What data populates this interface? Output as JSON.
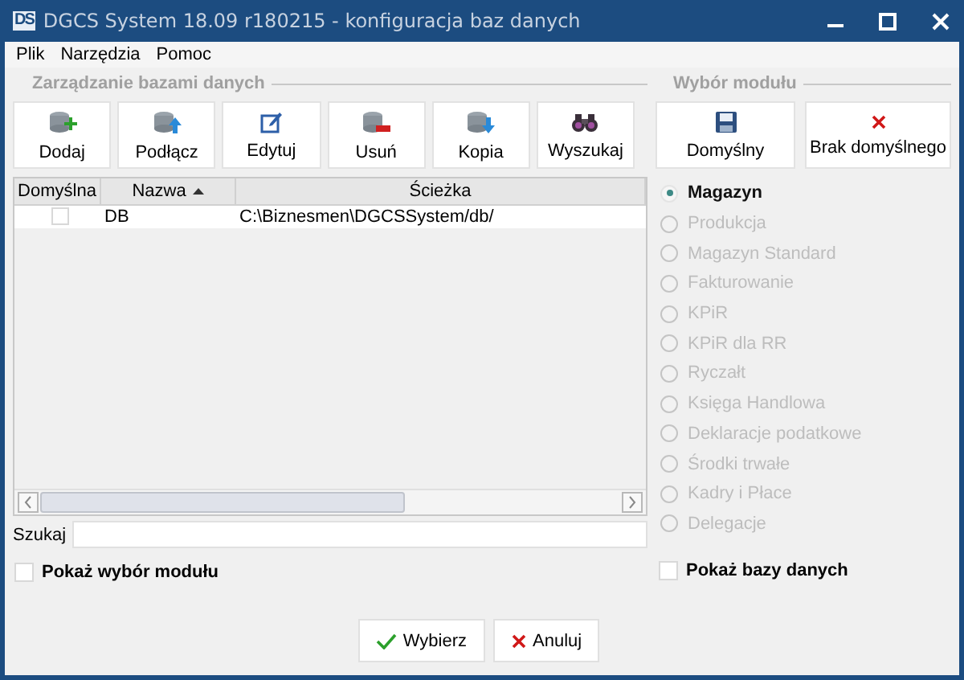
{
  "window": {
    "logo": "DS",
    "title": "DGCS System 18.09 r180215 - konfiguracja baz danych"
  },
  "menu": [
    "Plik",
    "Narzędzia",
    "Pomoc"
  ],
  "database_group": {
    "title": "Zarządzanie bazami danych",
    "buttons": [
      {
        "label": "Dodaj",
        "kind": "add"
      },
      {
        "label": "Podłącz",
        "kind": "connect"
      },
      {
        "label": "Edytuj",
        "kind": "edit"
      },
      {
        "label": "Usuń",
        "kind": "remove"
      },
      {
        "label": "Kopia",
        "kind": "copy"
      },
      {
        "label": "Wyszukaj",
        "kind": "search"
      }
    ]
  },
  "table": {
    "columns": [
      {
        "label": "Domyślna",
        "sorted": false
      },
      {
        "label": "Nazwa",
        "sorted": true
      },
      {
        "label": "Ścieżka",
        "sorted": false
      }
    ],
    "rows": [
      {
        "default": false,
        "name": "DB",
        "path": "C:\\Biznesmen\\DGCSSystem/db/"
      }
    ]
  },
  "search": {
    "label": "Szukaj"
  },
  "show_modules": {
    "label": "Pokaż wybór modułu",
    "checked": false
  },
  "module_group": {
    "title": "Wybór modułu",
    "buttons": [
      {
        "label": "Domyślny",
        "kind": "save"
      },
      {
        "label": "Brak domyślnego",
        "kind": "clear"
      }
    ],
    "modules": [
      {
        "label": "Magazyn",
        "selected": true,
        "disabled": false
      },
      {
        "label": "Produkcja",
        "selected": false,
        "disabled": true
      },
      {
        "label": "Magazyn Standard",
        "selected": false,
        "disabled": true
      },
      {
        "label": "Fakturowanie",
        "selected": false,
        "disabled": true
      },
      {
        "label": "KPiR",
        "selected": false,
        "disabled": true
      },
      {
        "label": "KPiR dla RR",
        "selected": false,
        "disabled": true
      },
      {
        "label": "Ryczałt",
        "selected": false,
        "disabled": true
      },
      {
        "label": "Księga Handlowa",
        "selected": false,
        "disabled": true
      },
      {
        "label": "Deklaracje podatkowe",
        "selected": false,
        "disabled": true
      },
      {
        "label": "Środki trwałe",
        "selected": false,
        "disabled": true
      },
      {
        "label": "Kadry i Płace",
        "selected": false,
        "disabled": true
      },
      {
        "label": "Delegacje",
        "selected": false,
        "disabled": true
      }
    ]
  },
  "show_databases": {
    "label": "Pokaż bazy danych",
    "checked": false
  },
  "footer_buttons": [
    {
      "label": "Wybierz",
      "kind": "confirm"
    },
    {
      "label": "Anuluj",
      "kind": "cancel"
    }
  ]
}
